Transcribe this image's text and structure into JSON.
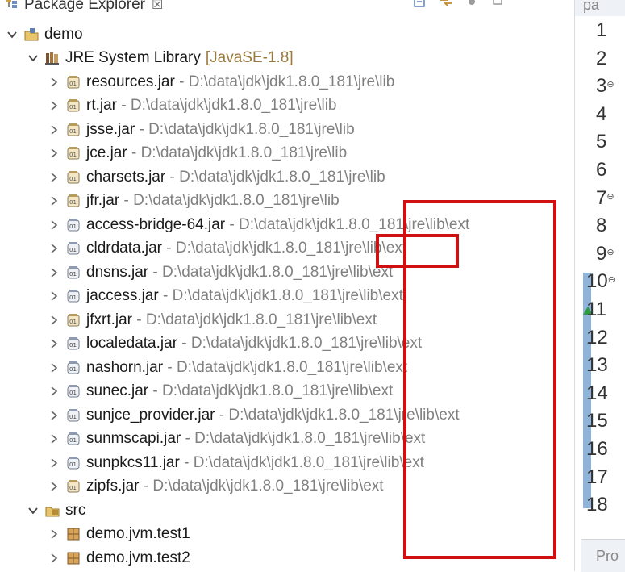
{
  "explorer": {
    "title": "Package Explorer",
    "close_label": "☒"
  },
  "tree": [
    {
      "level": 0,
      "expanded": true,
      "icon": "java-project-icon",
      "name": "demo",
      "path": "",
      "decoration": ""
    },
    {
      "level": 1,
      "expanded": true,
      "icon": "library-icon",
      "name": "JRE System Library",
      "path": "",
      "decoration": "[JavaSE-1.8]"
    },
    {
      "level": 2,
      "expanded": false,
      "icon": "jar-icon",
      "name": "resources.jar",
      "path": "D:\\data\\jdk\\jdk1.8.0_181\\jre\\lib",
      "decoration": ""
    },
    {
      "level": 2,
      "expanded": false,
      "icon": "jar-icon",
      "name": "rt.jar",
      "path": "D:\\data\\jdk\\jdk1.8.0_181\\jre\\lib",
      "decoration": ""
    },
    {
      "level": 2,
      "expanded": false,
      "icon": "jar-icon",
      "name": "jsse.jar",
      "path": "D:\\data\\jdk\\jdk1.8.0_181\\jre\\lib",
      "decoration": ""
    },
    {
      "level": 2,
      "expanded": false,
      "icon": "jar-icon",
      "name": "jce.jar",
      "path": "D:\\data\\jdk\\jdk1.8.0_181\\jre\\lib",
      "decoration": ""
    },
    {
      "level": 2,
      "expanded": false,
      "icon": "jar-icon",
      "name": "charsets.jar",
      "path": "D:\\data\\jdk\\jdk1.8.0_181\\jre\\lib",
      "decoration": ""
    },
    {
      "level": 2,
      "expanded": false,
      "icon": "jar-icon",
      "name": "jfr.jar",
      "path": "D:\\data\\jdk\\jdk1.8.0_181\\jre\\lib",
      "decoration": ""
    },
    {
      "level": 2,
      "expanded": false,
      "icon": "jar-ext-icon",
      "name": "access-bridge-64.jar",
      "path": "D:\\data\\jdk\\jdk1.8.0_181\\jre\\lib\\ext",
      "decoration": ""
    },
    {
      "level": 2,
      "expanded": false,
      "icon": "jar-ext-icon",
      "name": "cldrdata.jar",
      "path": "D:\\data\\jdk\\jdk1.8.0_181\\jre\\lib\\ext",
      "decoration": ""
    },
    {
      "level": 2,
      "expanded": false,
      "icon": "jar-ext-icon",
      "name": "dnsns.jar",
      "path": "D:\\data\\jdk\\jdk1.8.0_181\\jre\\lib\\ext",
      "decoration": ""
    },
    {
      "level": 2,
      "expanded": false,
      "icon": "jar-ext-icon",
      "name": "jaccess.jar",
      "path": "D:\\data\\jdk\\jdk1.8.0_181\\jre\\lib\\ext",
      "decoration": ""
    },
    {
      "level": 2,
      "expanded": false,
      "icon": "jar-icon",
      "name": "jfxrt.jar",
      "path": "D:\\data\\jdk\\jdk1.8.0_181\\jre\\lib\\ext",
      "decoration": ""
    },
    {
      "level": 2,
      "expanded": false,
      "icon": "jar-ext-icon",
      "name": "localedata.jar",
      "path": "D:\\data\\jdk\\jdk1.8.0_181\\jre\\lib\\ext",
      "decoration": ""
    },
    {
      "level": 2,
      "expanded": false,
      "icon": "jar-ext-icon",
      "name": "nashorn.jar",
      "path": "D:\\data\\jdk\\jdk1.8.0_181\\jre\\lib\\ext",
      "decoration": ""
    },
    {
      "level": 2,
      "expanded": false,
      "icon": "jar-ext-icon",
      "name": "sunec.jar",
      "path": "D:\\data\\jdk\\jdk1.8.0_181\\jre\\lib\\ext",
      "decoration": ""
    },
    {
      "level": 2,
      "expanded": false,
      "icon": "jar-ext-icon",
      "name": "sunjce_provider.jar",
      "path": "D:\\data\\jdk\\jdk1.8.0_181\\jre\\lib\\ext",
      "decoration": ""
    },
    {
      "level": 2,
      "expanded": false,
      "icon": "jar-ext-icon",
      "name": "sunmscapi.jar",
      "path": "D:\\data\\jdk\\jdk1.8.0_181\\jre\\lib\\ext",
      "decoration": ""
    },
    {
      "level": 2,
      "expanded": false,
      "icon": "jar-ext-icon",
      "name": "sunpkcs11.jar",
      "path": "D:\\data\\jdk\\jdk1.8.0_181\\jre\\lib\\ext",
      "decoration": ""
    },
    {
      "level": 2,
      "expanded": false,
      "icon": "jar-icon",
      "name": "zipfs.jar",
      "path": "D:\\data\\jdk\\jdk1.8.0_181\\jre\\lib\\ext",
      "decoration": ""
    },
    {
      "level": 1,
      "expanded": true,
      "icon": "source-folder-icon",
      "name": "src",
      "path": "",
      "decoration": ""
    },
    {
      "level": 2,
      "expanded": false,
      "icon": "package-icon",
      "name": "demo.jvm.test1",
      "path": "",
      "decoration": ""
    },
    {
      "level": 2,
      "expanded": false,
      "icon": "package-icon",
      "name": "demo.jvm.test2",
      "path": "",
      "decoration": ""
    }
  ],
  "editor": {
    "tab_label": "pa",
    "line_numbers": [
      "1",
      "2",
      "3",
      "4",
      "5",
      "6",
      "7",
      "8",
      "9",
      "10",
      "11",
      "12",
      "13",
      "14",
      "15",
      "16",
      "17",
      "18"
    ],
    "fold_markers": [
      "3",
      "7",
      "9",
      "10"
    ],
    "problems_tab_label": "Pro"
  },
  "colors": {
    "highlight_box": "#d01010",
    "ruler": "#8fb3d9",
    "path_text": "#808080",
    "decoration_text": "#9b7a3c"
  }
}
